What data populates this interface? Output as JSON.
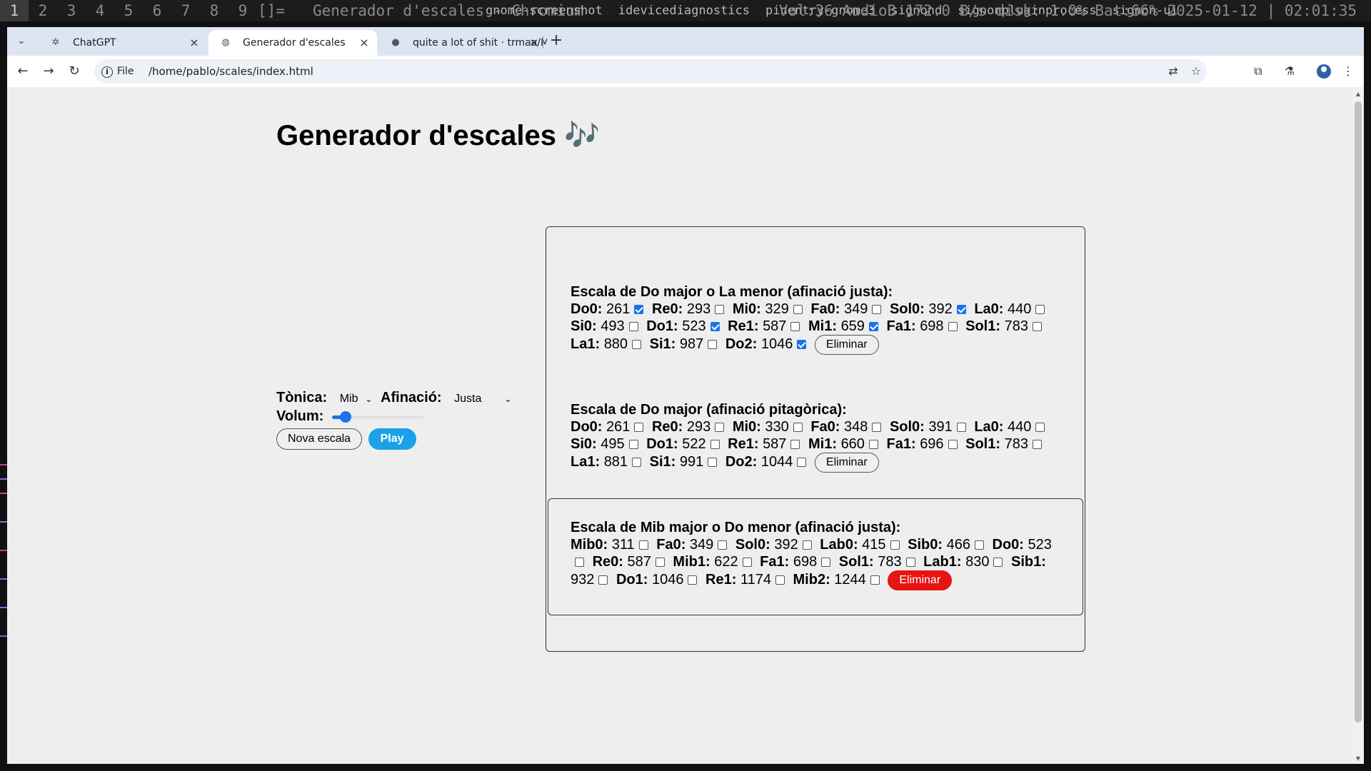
{
  "system_bar": {
    "workspaces": [
      "1",
      "2",
      "3",
      "4",
      "5",
      "6",
      "7",
      "8",
      "9",
      "[]="
    ],
    "window_title": "Generador d'escales - Chromium",
    "tray": [
      "gnome-screenshot",
      "idevicediagnostics",
      "pinentry-gnome3",
      "signond",
      "signonpluginprocess",
      "signon-ui"
    ],
    "status": "Vol:36 AudioB 172.0 B/s disk: 1.0% Bat:66% 2025-01-12 | 02:01:35"
  },
  "browser": {
    "tabs": [
      {
        "title": "ChatGPT",
        "icon": "openai-icon",
        "active": false
      },
      {
        "title": "Generador d'escales",
        "icon": "globe-icon",
        "active": true
      },
      {
        "title": "quite a lot of shit · trmaa/Mu",
        "icon": "github-icon",
        "active": false
      }
    ],
    "close_glyph": "×",
    "new_tab_glyph": "+",
    "chip_label": "File",
    "url": "/home/pablo/scales/index.html"
  },
  "page": {
    "title": "Generador d'escales 🎶",
    "controls": {
      "tonic_label": "Tònica:",
      "tonic_value": "Mib",
      "tuning_label": "Afinació:",
      "tuning_value": "Justa",
      "volume_label": "Volum:",
      "volume_fraction": 0.1,
      "new_scale_label": "Nova escala",
      "play_label": "Play"
    },
    "scales": [
      {
        "title": "Escala de Do major o La menor (afinació justa):",
        "notes": [
          {
            "name": "Do0:",
            "freq": "261",
            "checked": true
          },
          {
            "name": "Re0:",
            "freq": "293",
            "checked": false
          },
          {
            "name": "Mi0:",
            "freq": "329",
            "checked": false
          },
          {
            "name": "Fa0:",
            "freq": "349",
            "checked": false
          },
          {
            "name": "Sol0:",
            "freq": "392",
            "checked": true
          },
          {
            "name": "La0:",
            "freq": "440",
            "checked": false
          },
          {
            "name": "Si0:",
            "freq": "493",
            "checked": false
          },
          {
            "name": "Do1:",
            "freq": "523",
            "checked": true
          },
          {
            "name": "Re1:",
            "freq": "587",
            "checked": false
          },
          {
            "name": "Mi1:",
            "freq": "659",
            "checked": true
          },
          {
            "name": "Fa1:",
            "freq": "698",
            "checked": false
          },
          {
            "name": "Sol1:",
            "freq": "783",
            "checked": false
          },
          {
            "name": "La1:",
            "freq": "880",
            "checked": false
          },
          {
            "name": "Si1:",
            "freq": "987",
            "checked": false
          },
          {
            "name": "Do2:",
            "freq": "1046",
            "checked": true
          }
        ],
        "delete_label": "Eliminar"
      },
      {
        "title": "Escala de Do major (afinació pitagòrica):",
        "notes": [
          {
            "name": "Do0:",
            "freq": "261",
            "checked": false
          },
          {
            "name": "Re0:",
            "freq": "293",
            "checked": false
          },
          {
            "name": "Mi0:",
            "freq": "330",
            "checked": false
          },
          {
            "name": "Fa0:",
            "freq": "348",
            "checked": false
          },
          {
            "name": "Sol0:",
            "freq": "391",
            "checked": false
          },
          {
            "name": "La0:",
            "freq": "440",
            "checked": false
          },
          {
            "name": "Si0:",
            "freq": "495",
            "checked": false
          },
          {
            "name": "Do1:",
            "freq": "522",
            "checked": false
          },
          {
            "name": "Re1:",
            "freq": "587",
            "checked": false
          },
          {
            "name": "Mi1:",
            "freq": "660",
            "checked": false
          },
          {
            "name": "Fa1:",
            "freq": "696",
            "checked": false
          },
          {
            "name": "Sol1:",
            "freq": "783",
            "checked": false
          },
          {
            "name": "La1:",
            "freq": "881",
            "checked": false
          },
          {
            "name": "Si1:",
            "freq": "991",
            "checked": false
          },
          {
            "name": "Do2:",
            "freq": "1044",
            "checked": false
          }
        ],
        "delete_label": "Eliminar"
      },
      {
        "title": "Escala de Mib major o Do menor (afinació justa):",
        "notes": [
          {
            "name": "Mib0:",
            "freq": "311",
            "checked": false
          },
          {
            "name": "Fa0:",
            "freq": "349",
            "checked": false
          },
          {
            "name": "Sol0:",
            "freq": "392",
            "checked": false
          },
          {
            "name": "Lab0:",
            "freq": "415",
            "checked": false
          },
          {
            "name": "Sib0:",
            "freq": "466",
            "checked": false
          },
          {
            "name": "Do0:",
            "freq": "523",
            "checked": false
          },
          {
            "name": "Re0:",
            "freq": "587",
            "checked": false
          },
          {
            "name": "Mib1:",
            "freq": "622",
            "checked": false
          },
          {
            "name": "Fa1:",
            "freq": "698",
            "checked": false
          },
          {
            "name": "Sol1:",
            "freq": "783",
            "checked": false
          },
          {
            "name": "Lab1:",
            "freq": "830",
            "checked": false
          },
          {
            "name": "Sib1:",
            "freq": "932",
            "checked": false
          },
          {
            "name": "Do1:",
            "freq": "1046",
            "checked": false
          },
          {
            "name": "Re1:",
            "freq": "1174",
            "checked": false
          },
          {
            "name": "Mib2:",
            "freq": "1244",
            "checked": false
          }
        ],
        "delete_label": "Eliminar",
        "selected": true
      }
    ]
  },
  "colors": {
    "accent_blue": "#1a73e8",
    "play_blue": "#1ba1e8",
    "danger_red": "#e81313",
    "page_bg": "#eeeeee",
    "tabstrip_bg": "#dde4f2"
  }
}
